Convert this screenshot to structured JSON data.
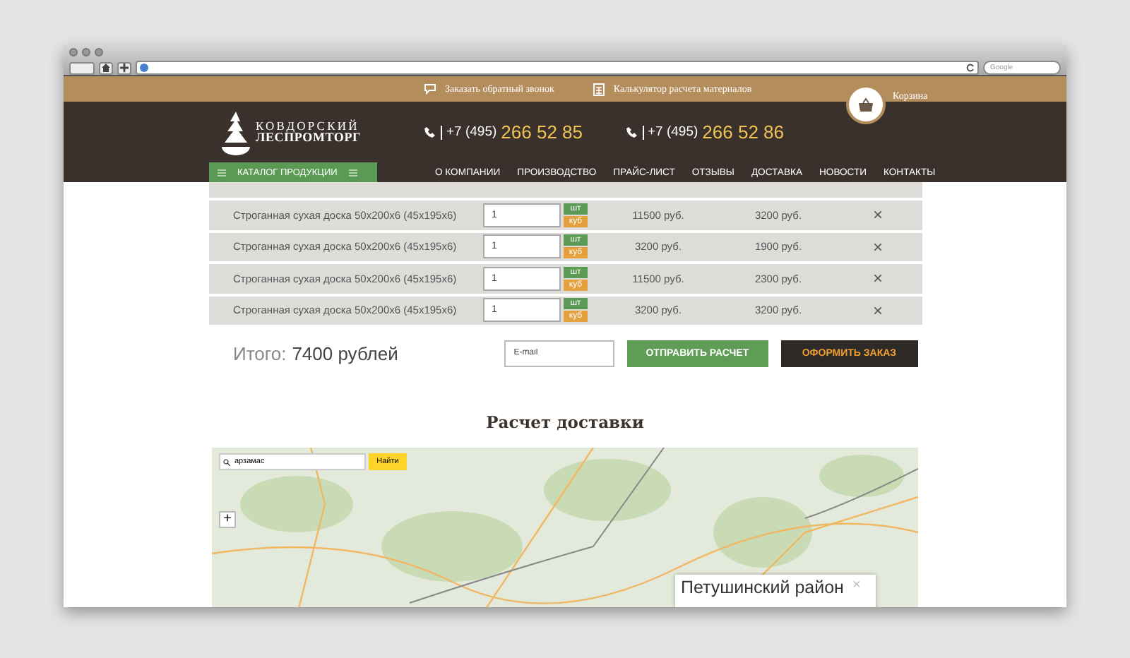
{
  "browser": {
    "search_placeholder": "Google"
  },
  "topbar": {
    "links": [
      {
        "label": "Заказать обратный звонок",
        "kind": "callback"
      },
      {
        "label": "Калькулятор расчета материалов",
        "kind": "calculator"
      }
    ],
    "cart": "Корзина"
  },
  "header": {
    "logo": [
      "КОВДОРСКИЙ",
      "ЛЕСПРОМТОРГ"
    ],
    "phones": [
      {
        "prefix": "+7 (495)",
        "number": "266 52 85"
      },
      {
        "prefix": "+7 (495)",
        "number": "266 52 86"
      }
    ]
  },
  "nav": {
    "catalog": "КАТАЛОГ ПРОДУКЦИИ",
    "items": [
      "О КОМПАНИИ",
      "ПРОИЗВОДСТВО",
      "ПРАЙС-ЛИСТ",
      "ОТЗЫВЫ",
      "ДОСТАВКА",
      "НОВОСТИ",
      "КОНТАКТЫ"
    ]
  },
  "cart": {
    "rows": [
      {
        "name": "Строганная сухая доска 50х200х6 (45х195х6)",
        "quantity": "1",
        "units": [
          "шт",
          "куб"
        ],
        "price": "11500 руб.",
        "sum": "3200 руб.",
        "remove": "×"
      },
      {
        "name": "Строганная сухая доска 50х200х6 (45х195х6)",
        "quantity": "1",
        "units": [
          "шт",
          "куб"
        ],
        "price": "3200 руб.",
        "sum": "1900 руб.",
        "remove": "×"
      },
      {
        "name": "Строганная сухая доска 50х200х6 (45х195х6)",
        "quantity": "1",
        "units": [
          "шт",
          "куб"
        ],
        "price": "11500 руб.",
        "sum": "2300 руб.",
        "remove": "×"
      },
      {
        "name": "Строганная сухая доска 50х200х6 (45х195х6)",
        "quantity": "1",
        "units": [
          "шт",
          "куб"
        ],
        "price": "3200 руб.",
        "sum": "3200 руб.",
        "remove": "×"
      }
    ],
    "total_label": "Итого:",
    "total": "7400 рублей",
    "email_placeholder": "E-mail",
    "send_button": "ОТПРАВИТЬ РАСЧЕТ",
    "order_button": "ОФОРМИТЬ ЗАКАЗ"
  },
  "delivery": {
    "title": "Расчет доставки",
    "map": {
      "search_value": "арзамас",
      "search_button": "Найти",
      "zoom_in": "+",
      "popup_title": "Петушинский район",
      "popup_close": "×"
    }
  }
}
